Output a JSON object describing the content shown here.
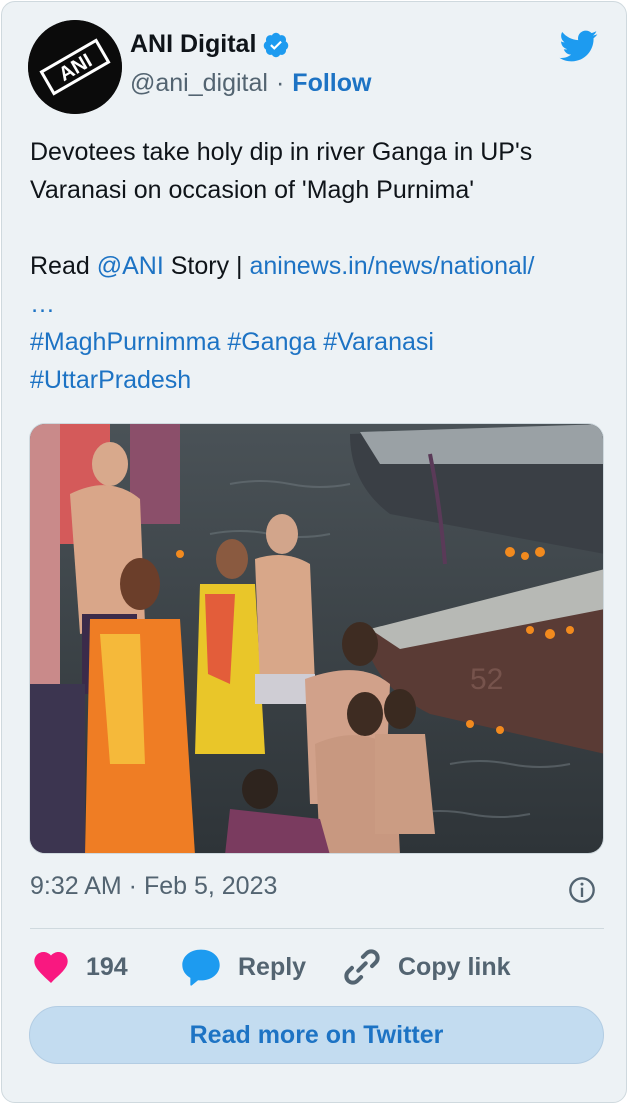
{
  "author": {
    "name": "ANI Digital",
    "handle": "@ani_digital",
    "separator": "·",
    "follow_label": "Follow",
    "avatar_text": "ANI"
  },
  "tweet": {
    "line1": "Devotees take holy dip in river Ganga in UP's",
    "line2": "Varanasi on occasion of 'Magh Purnima'",
    "read_prefix": "Read",
    "mention": "@ANI",
    "story_text": "Story |",
    "url": "aninews.in/news/national/",
    "ellipsis": "…",
    "hashtags_line1": [
      "#MaghPurnimma",
      "#Ganga",
      "#Varanasi"
    ],
    "hashtags_line2": [
      "#UttarPradesh"
    ]
  },
  "meta": {
    "timestamp": "9:32 AM · Feb 5, 2023"
  },
  "actions": {
    "likes": "194",
    "reply_label": "Reply",
    "copy_label": "Copy link"
  },
  "read_more_label": "Read more on Twitter",
  "colors": {
    "card_bg": "#edf2f5",
    "link": "#1d73c4",
    "like": "#f91880",
    "reply_icon": "#1d9bf0",
    "twitter_bird": "#1d9bf0",
    "verified": "#1d9bf0"
  },
  "icons": {
    "verified": "verified-badge-icon",
    "brand": "twitter-bird-icon",
    "info": "info-icon",
    "like": "heart-icon",
    "reply": "speech-bubble-icon",
    "copy": "link-icon"
  }
}
